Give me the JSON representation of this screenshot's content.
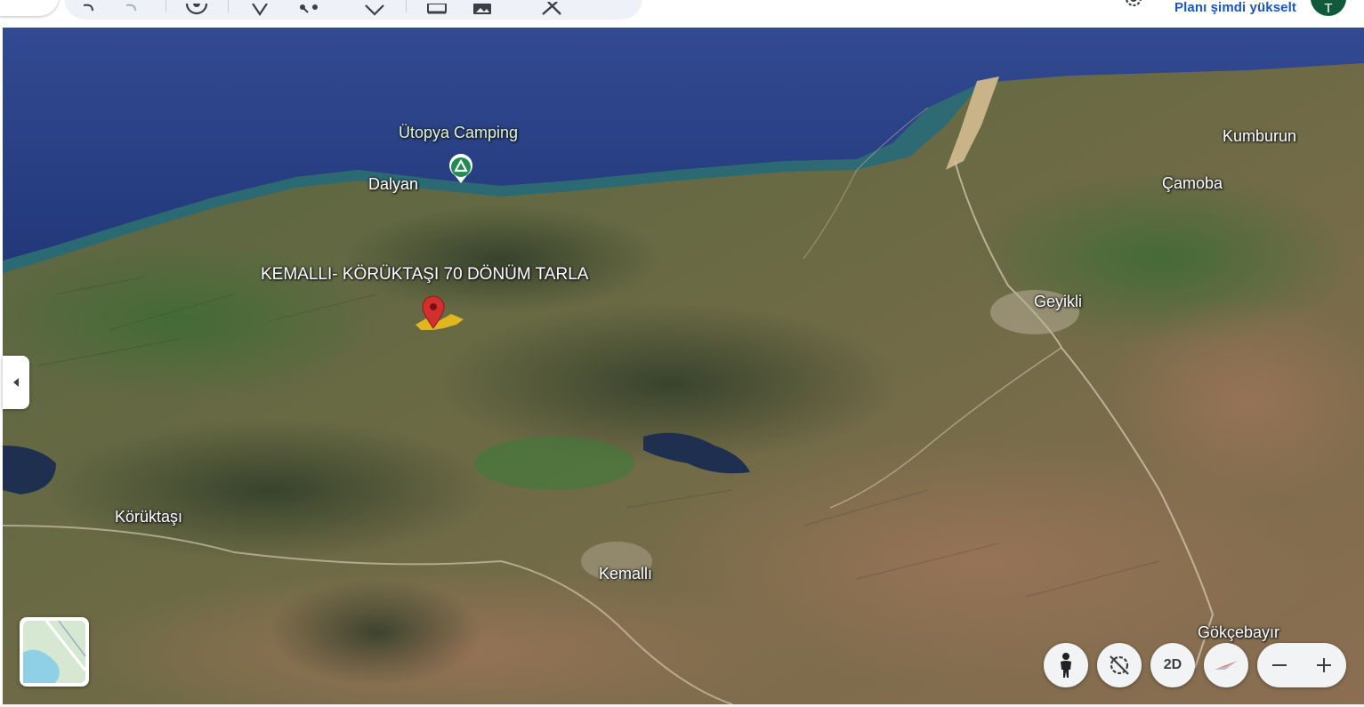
{
  "header": {
    "upgrade_link": "Planı şimdi yükselt",
    "avatar_letter": "T",
    "toolbar_icons": [
      "undo-icon",
      "redo-icon",
      "target-icon",
      "add-placemark-icon",
      "path-icon",
      "polygon-icon",
      "project-icon",
      "image-icon",
      "measure-icon"
    ],
    "settings_icon": "gear-icon"
  },
  "map": {
    "placemark_title": "KEMALLI- KÖRÜKTAŞI 70 DÖNÜM TARLA",
    "poi_camping": "Ütopya Camping",
    "places": {
      "dalyan": "Dalyan",
      "kumburun": "Kumburun",
      "camoba": "Çamoba",
      "geyikli": "Geyikli",
      "koruktasi": "Körüktaşı",
      "kemalli": "Kemallı",
      "gokcebayir": "Gökçebayır"
    },
    "colors": {
      "sea": "#2a3f86",
      "coast": "#1d6e86",
      "placemark_pin": "#d32f2f",
      "camp_pin": "#1e8e4e",
      "parcel": "#f5c518"
    }
  },
  "controls": {
    "sidebar_toggle_icon": "chevron-left-icon",
    "layers_icon": "map-layers-thumbnail",
    "pegman_icon": "pegman-icon",
    "tilt_icon": "no-tilt-icon",
    "view_mode_label": "2D",
    "compass_icon": "compass-icon",
    "zoom_out_icon": "minus-icon",
    "zoom_in_icon": "plus-icon"
  }
}
